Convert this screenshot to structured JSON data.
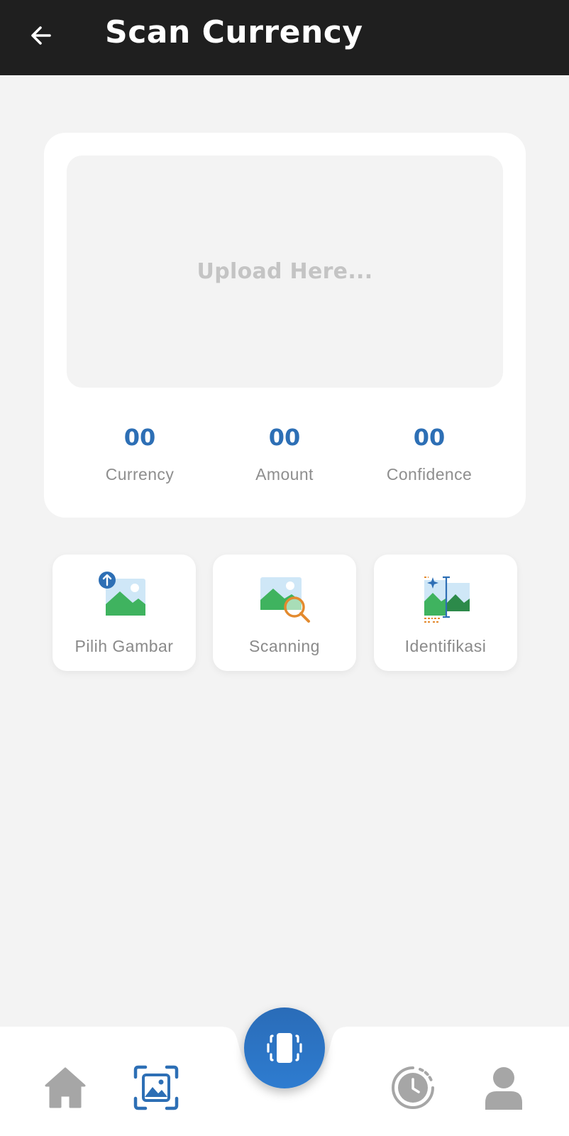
{
  "header": {
    "title": "Scan Currency",
    "back_icon": "arrow-left-icon"
  },
  "upload": {
    "placeholder": "Upload Here..."
  },
  "stats": [
    {
      "value": "00",
      "label": "Currency"
    },
    {
      "value": "00",
      "label": "Amount"
    },
    {
      "value": "00",
      "label": "Confidence"
    }
  ],
  "actions": [
    {
      "label": "Pilih Gambar",
      "icon": "image-upload-icon"
    },
    {
      "label": "Scanning",
      "icon": "image-search-icon"
    },
    {
      "label": "Identifikasi",
      "icon": "image-identify-icon"
    }
  ],
  "nav": {
    "items": [
      {
        "icon": "home-icon",
        "active": false
      },
      {
        "icon": "gallery-scan-icon",
        "active": true
      },
      {
        "icon": "history-clock-icon",
        "active": false
      },
      {
        "icon": "profile-icon",
        "active": false
      }
    ],
    "fab_icon": "scan-phone-icon"
  },
  "colors": {
    "appbar": "#1f1f1f",
    "accent": "#2d6fb5",
    "background": "#f3f3f3",
    "inactive_icon": "#a6a6a6"
  }
}
